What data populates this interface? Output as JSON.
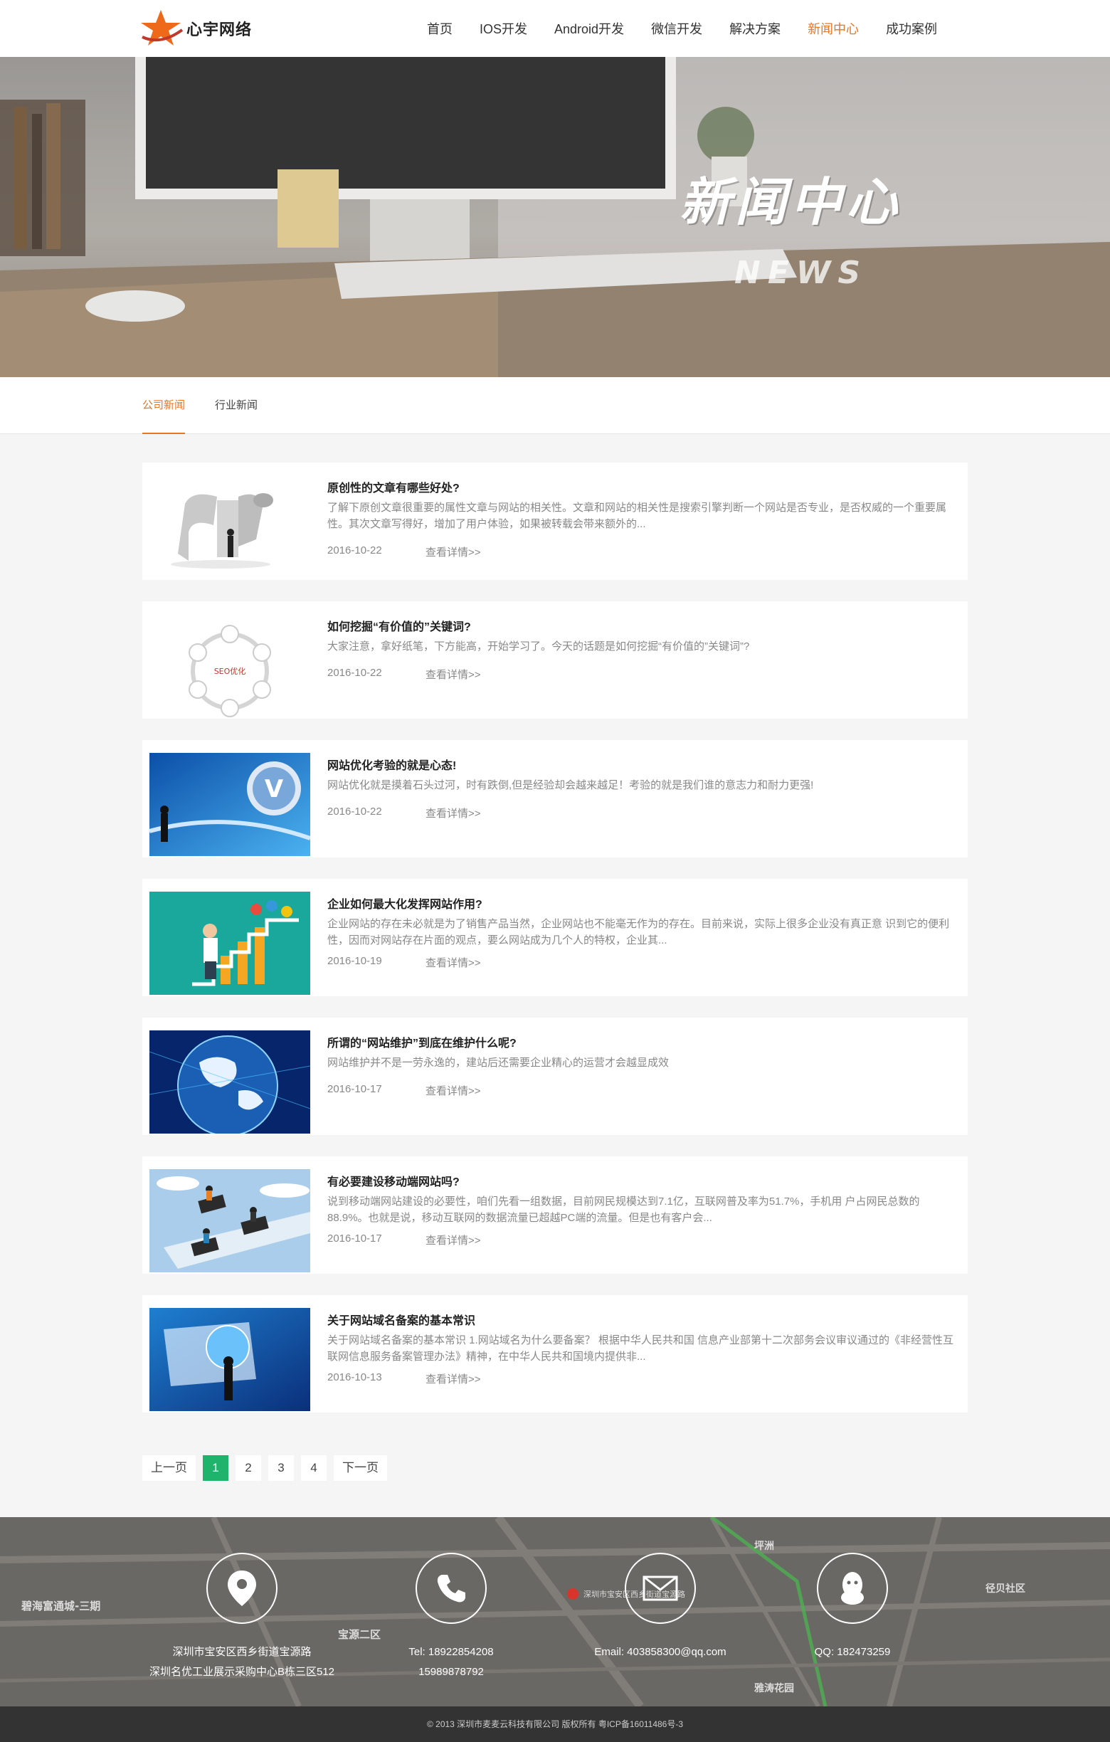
{
  "brand": {
    "name": "心宇网络"
  },
  "nav": [
    {
      "label": "首页"
    },
    {
      "label": "IOS开发"
    },
    {
      "label": "Android开发"
    },
    {
      "label": "微信开发"
    },
    {
      "label": "解决方案"
    },
    {
      "label": "新闻中心",
      "active": true
    },
    {
      "label": "成功案例"
    }
  ],
  "banner": {
    "title": "新闻中心",
    "subtitle": "NEWS"
  },
  "tabs": [
    {
      "label": "公司新闻",
      "active": true
    },
    {
      "label": "行业新闻"
    }
  ],
  "news": [
    {
      "title": "原创性的文章有哪些好处?",
      "desc": "了解下原创文章很重要的属性文章与网站的相关性。文章和网站的相关性是搜索引擎判断一个网站是否专业，是否权威的一个重要属性。其次文章写得好，增加了用户体验，如果被转载会带来额外的...",
      "date": "2016-10-22",
      "more": "查看详情>>",
      "thumb": "seo-3d-letters"
    },
    {
      "title": "如何挖掘“有价值的”关键词?",
      "desc": "大家注意，拿好纸笔，下方能高，开始学习了。今天的话题是如何挖掘“有价值的”关键词”?",
      "date": "2016-10-22",
      "more": "查看详情>>",
      "thumb": "seo-cycle-diagram",
      "thumb_label": "SEO优化"
    },
    {
      "title": "网站优化考验的就是心态!",
      "desc": "网站优化就是摸着石头过河，时有跌倒,但是经验却会越来越足！考验的就是我们谁的意志力和耐力更强!",
      "date": "2016-10-22",
      "more": "查看详情>>",
      "thumb": "www-globe"
    },
    {
      "title": "企业如何最大化发挥网站作用?",
      "desc": "企业网站的存在未必就是为了销售产品当然，企业网站也不能毫无作为的存在。目前来说，实际上很多企业没有真正意 识到它的便利性，因而对网站存在片面的观点，要么网站成为几个人的特权，企业其...",
      "date": "2016-10-19",
      "more": "查看详情>>",
      "thumb": "growth-stairs"
    },
    {
      "title": "所谓的“网站维护”到底在维护什么呢?",
      "desc": "网站维护并不是一劳永逸的，建站后还需要企业精心的运营才会越显成效",
      "date": "2016-10-17",
      "more": "查看详情>>",
      "thumb": "blue-globe"
    },
    {
      "title": "有必要建设移动端网站吗?",
      "desc": "说到移动端网站建设的必要性，咱们先看一组数据，目前网民规模达到7.1亿，互联网普及率为51.7%，手机用 户占网民总数的88.9%。也就是说，移动互联网的数据流量已超越PC端的流量。但是也有客户会...",
      "date": "2016-10-17",
      "more": "查看详情>>",
      "thumb": "mobile-people"
    },
    {
      "title": "关于网站域名备案的基本常识",
      "desc": "关于网站域名备案的基本常识 1.网站域名为什么要备案？ 根据中华人民共和国 信息产业部第十二次部务会议审议通过的《非经营性互联网信息服务备案管理办法》精神，在中华人民共和国境内提供非...",
      "date": "2016-10-13",
      "more": "查看详情>>",
      "thumb": "laptop-globe"
    }
  ],
  "pagination": {
    "prev": "上一页",
    "pages": [
      "1",
      "2",
      "3",
      "4"
    ],
    "current": "1",
    "next": "下一页"
  },
  "footer": {
    "address": [
      "深圳市宝安区西乡街道宝源路",
      "深圳名优工业展示采购中心B栋三区512"
    ],
    "tel": [
      "Tel:  18922854208",
      "15989878792"
    ],
    "email": "Email:  403858300@qq.com",
    "qq": "QQ:  182473259",
    "map_labels": [
      "碧海富通城-三期",
      "宝源二区",
      "径贝社区",
      "雅涛花园",
      "坪洲",
      "深圳市宝安区西乡街道宝源路"
    ],
    "copyright": "© 2013 深圳市麦麦云科技有限公司 版权所有 粤ICP备16011486号-3"
  },
  "colors": {
    "accent": "#e87722",
    "pager_active": "#1fb36b",
    "footer_bg": "#5c5a56",
    "copyright_bg": "#333333"
  }
}
